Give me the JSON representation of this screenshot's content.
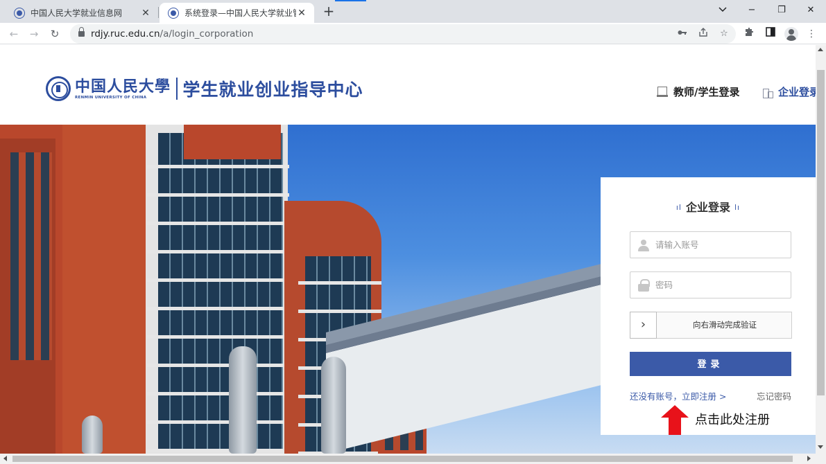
{
  "browser": {
    "tabs": [
      {
        "title": "中国人民大学就业信息网",
        "close": "✕"
      },
      {
        "title": "系统登录—中国人民大学就业管理",
        "close": "✕"
      }
    ],
    "new_tab": "+",
    "window_controls": {
      "minimize": "−",
      "restore": "❐",
      "close": "✕"
    },
    "url_host": "rdjy.ruc.edu.cn",
    "url_path": "/a/login_corporation",
    "icons": [
      "back-icon",
      "forward-icon",
      "reload-icon",
      "lock-icon",
      "key-icon",
      "share-icon",
      "star-icon",
      "extensions-icon",
      "side-panel-icon",
      "profile-icon",
      "menu-icon"
    ]
  },
  "header": {
    "logo_cn": "中国人民大學",
    "logo_en": "RENMIN UNIVERSITY OF CHINA",
    "logo_sub": "学生就业创业指导中心",
    "teacher_login": "教师/学生登录",
    "corp_login": "企业登录",
    "accent": "#2c4d9e"
  },
  "login": {
    "title": "企业登录",
    "account_placeholder": "请输入账号",
    "password_placeholder": "密码",
    "slider_text": "向右滑动完成验证",
    "slider_handle": "›",
    "submit": "登录",
    "register": "还没有账号，立即注册 >",
    "forgot": "忘记密码",
    "button_color": "#3b5aa8"
  },
  "annotation": {
    "text": "点击此处注册",
    "arrow_color": "#e8121a"
  }
}
